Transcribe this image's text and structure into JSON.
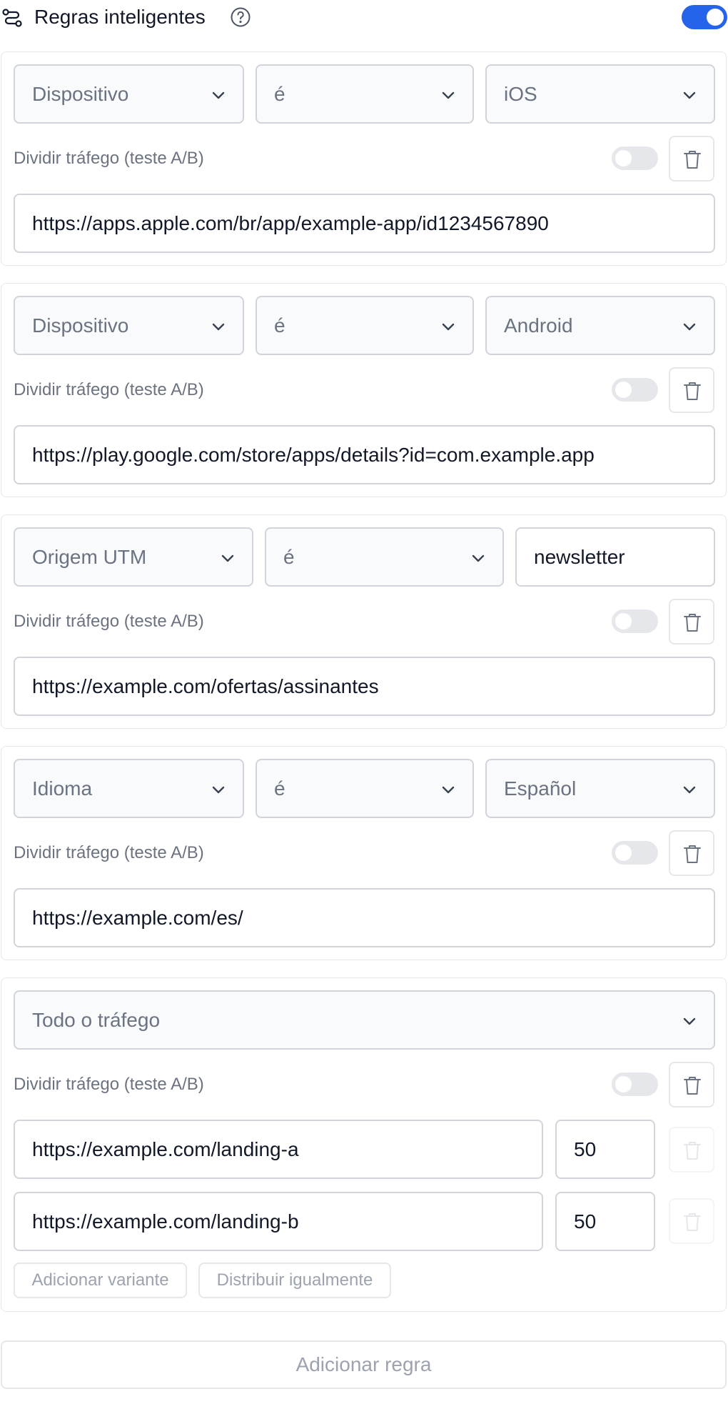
{
  "header": {
    "title": "Regras inteligentes",
    "rules_icon": "branch-rules-icon",
    "help_icon": "question-circle-icon",
    "enabled": true,
    "accent_color": "#2563eb"
  },
  "split_label": "Dividir tráfego (teste A/B)",
  "rules": [
    {
      "field": "Dispositivo",
      "operator": "é",
      "value": "iOS",
      "split_enabled": false,
      "url": "https://apps.apple.com/br/app/example-app/id1234567890"
    },
    {
      "field": "Dispositivo",
      "operator": "é",
      "value": "Android",
      "split_enabled": false,
      "url": "https://play.google.com/store/apps/details?id=com.example.app"
    },
    {
      "field": "Origem UTM",
      "operator": "é",
      "value": "newsletter",
      "split_enabled": false,
      "url": "https://example.com/ofertas/assinantes"
    },
    {
      "field": "Idioma",
      "operator": "é",
      "value": "Español",
      "split_enabled": false,
      "url": "https://example.com/es/"
    },
    {
      "field": "Todo o tráfego",
      "split_enabled": false,
      "variants": [
        {
          "url": "https://example.com/landing-a",
          "weight": "50"
        },
        {
          "url": "https://example.com/landing-b",
          "weight": "50"
        }
      ],
      "add_variant_label": "Adicionar variante",
      "distribute_label": "Distribuir igualmente"
    }
  ],
  "add_rule_label": "Adicionar regra"
}
